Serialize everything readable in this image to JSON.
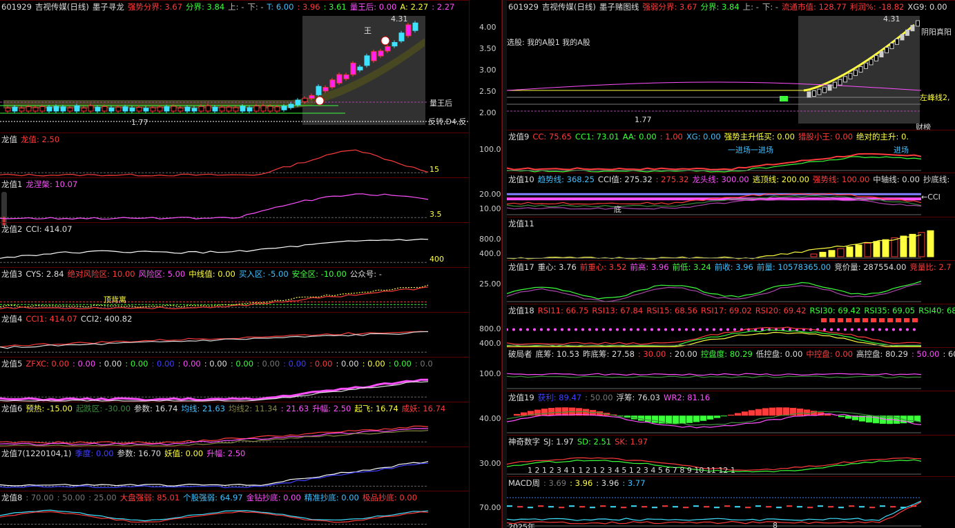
{
  "title_bar": {
    "code": "601929",
    "name": "吉视传媒(日线)"
  },
  "left": {
    "main": {
      "items": [
        {
          "t": "墨子寻龙",
          "c": "#ddd"
        },
        {
          "t": "强势分界: 3.67",
          "c": "#ff3c3c"
        },
        {
          "t": "分界: 3.84",
          "c": "#3cff3c"
        },
        {
          "t": "上: -",
          "c": "#bbb"
        },
        {
          "t": "下: -",
          "c": "#bbb"
        },
        {
          "t": "T: 6.00",
          "c": "#40c0ff"
        },
        {
          "t": ": 3.96",
          "c": "#ff3c3c"
        },
        {
          "t": ": 3.61",
          "c": "#3cff3c"
        },
        {
          "t": "量王后: 0.00",
          "c": "#ff50ff"
        },
        {
          "t": "A: 2.27",
          "c": "#ffff40"
        },
        {
          "t": ": 2.27",
          "c": "#ff50ff"
        }
      ],
      "ticks": [
        "4.00",
        "3.50",
        "3.00",
        "2.50",
        "2.00"
      ],
      "low_label": "1.77",
      "high_label": "4.31",
      "right_labels": [
        "量王后",
        "反转,D4,反"
      ],
      "text_wang": "王"
    },
    "panels": [
      {
        "items": [
          {
            "t": "龙值",
            "c": "#ddd"
          },
          {
            "t": "龙值: 2.50",
            "c": "#ff3c3c"
          }
        ],
        "ticks": [
          "100.0"
        ],
        "marks": [
          "15"
        ]
      },
      {
        "items": [
          {
            "t": "龙值1",
            "c": "#ddd"
          },
          {
            "t": "龙涅槃: 10.07",
            "c": "#ff50ff"
          }
        ],
        "ticks": [
          "20.00",
          "10.00"
        ],
        "marks": [
          "3.5"
        ]
      },
      {
        "items": [
          {
            "t": "龙值2",
            "c": "#ddd"
          },
          {
            "t": "CCI: 414.07",
            "c": "#ddd"
          }
        ],
        "ticks": [
          "800.0",
          "400.0"
        ],
        "marks": [
          "400"
        ]
      },
      {
        "items": [
          {
            "t": "龙值3",
            "c": "#ddd"
          },
          {
            "t": "CYS: 2.84",
            "c": "#ddd"
          },
          {
            "t": "绝对风险区: 10.00",
            "c": "#ff3c3c"
          },
          {
            "t": "风险区: 5.00",
            "c": "#ff50ff"
          },
          {
            "t": "中线值: 0.00",
            "c": "#ffff40"
          },
          {
            "t": "买入区: -5.00",
            "c": "#40c0ff"
          },
          {
            "t": "安全区: -10.00",
            "c": "#3cff3c"
          },
          {
            "t": "公众号: -",
            "c": "#ddd"
          }
        ],
        "ticks": [
          "25.00"
        ],
        "marks": [
          "顶背离"
        ]
      },
      {
        "items": [
          {
            "t": "龙值4",
            "c": "#ddd"
          },
          {
            "t": "CCI1: 414.07",
            "c": "#ff3c3c"
          },
          {
            "t": "CCI2: 400.82",
            "c": "#ddd"
          }
        ],
        "ticks": [
          "800.0",
          "400.0"
        ],
        "marks": []
      },
      {
        "items": [
          {
            "t": "龙值5",
            "c": "#ddd"
          },
          {
            "t": "ZFXC: 0.00",
            "c": "#ff3c3c"
          },
          {
            "t": ": 0.00",
            "c": "#ff50ff"
          },
          {
            "t": ": 0.00",
            "c": "#ddd"
          },
          {
            "t": ": 0.00",
            "c": "#3cff3c"
          },
          {
            "t": ": 0.00",
            "c": "#4040ff"
          },
          {
            "t": ": 0.00",
            "c": "#ff50ff"
          },
          {
            "t": ": 0.00",
            "c": "#ddd"
          },
          {
            "t": ": 0.00",
            "c": "#3cff3c"
          },
          {
            "t": ": 0.00",
            "c": "#777"
          },
          {
            "t": ": 0.00",
            "c": "#4040ff"
          },
          {
            "t": ": 0.00",
            "c": "#ff3c3c"
          },
          {
            "t": ": 0.00",
            "c": "#ddd"
          },
          {
            "t": ": 0.00",
            "c": "#ffff40"
          },
          {
            "t": ": 0.00",
            "c": "#3cff3c"
          },
          {
            "t": ": 0.0",
            "c": "#777"
          }
        ],
        "ticks": [
          "100.0"
        ],
        "marks": []
      },
      {
        "items": [
          {
            "t": "龙值6",
            "c": "#ddd"
          },
          {
            "t": "预热: -15.00",
            "c": "#ffff40"
          },
          {
            "t": "起跌区: -30.00",
            "c": "#3c8c3c"
          },
          {
            "t": "参数: 16.74",
            "c": "#ddd"
          },
          {
            "t": "均线: 21.63",
            "c": "#40c0ff"
          },
          {
            "t": "均线2: 11.34",
            "c": "#888844"
          },
          {
            "t": ": 21.63",
            "c": "#ff50ff"
          },
          {
            "t": "升幅: 2.50",
            "c": "#ff50ff"
          },
          {
            "t": "起飞: 16.74",
            "c": "#ffff40"
          },
          {
            "t": "成妖: 16.74",
            "c": "#ff3c3c"
          }
        ],
        "ticks": [
          "40.00"
        ],
        "marks": []
      },
      {
        "items": [
          {
            "t": "龙值7(1220104,1)",
            "c": "#ddd"
          },
          {
            "t": "季度: 0.00",
            "c": "#4040ff"
          },
          {
            "t": "参数: 16.70",
            "c": "#ddd"
          },
          {
            "t": "妖值: 0.00",
            "c": "#ffff40"
          },
          {
            "t": "升幅: 2.50",
            "c": "#ff50ff"
          }
        ],
        "ticks": [
          "30.00"
        ],
        "marks": []
      },
      {
        "items": [
          {
            "t": "龙值8",
            "c": "#ddd"
          },
          {
            "t": ": 70.00",
            "c": "#777"
          },
          {
            "t": ": 50.00",
            "c": "#777"
          },
          {
            "t": ": 25.00",
            "c": "#777"
          },
          {
            "t": "大盘强弱: 85.01",
            "c": "#ff3c3c"
          },
          {
            "t": "个股强弱: 64.97",
            "c": "#40c0ff"
          },
          {
            "t": "金钻抄底: 0.00",
            "c": "#ff50ff"
          },
          {
            "t": "精准抄底: 0.00",
            "c": "#40c0ff"
          },
          {
            "t": "极品抄底: 0.00",
            "c": "#ff3c3c"
          }
        ],
        "ticks": [
          "70.00"
        ],
        "marks": []
      }
    ]
  },
  "right": {
    "main": {
      "items": [
        {
          "t": "墨子赌图线",
          "c": "#ddd"
        },
        {
          "t": "强弱分界: 3.67",
          "c": "#ff3c3c"
        },
        {
          "t": "分界: 3.84",
          "c": "#3cff3c"
        },
        {
          "t": "上: -",
          "c": "#bbb"
        },
        {
          "t": "下: -",
          "c": "#bbb"
        },
        {
          "t": "流通市值: 128.77",
          "c": "#ff3c3c"
        },
        {
          "t": "利润%: -18.82",
          "c": "#ff3c3c"
        },
        {
          "t": "XG9: 0.00",
          "c": "#ddd"
        }
      ],
      "selection": "选股: 我的A股1 我的A股",
      "high_label": "4.31",
      "low_label": "1.77",
      "right_labels": [
        "阴阳真阳",
        "左峰线2,",
        "财榜"
      ]
    },
    "panels": [
      {
        "items": [
          {
            "t": "龙值9",
            "c": "#ddd"
          },
          {
            "t": "CC: 75.65",
            "c": "#ff3c3c"
          },
          {
            "t": "CC1: 73.01",
            "c": "#3cff3c"
          },
          {
            "t": "AA: 0.00",
            "c": "#3cff3c"
          },
          {
            "t": ": 1.00",
            "c": "#ff3c3c"
          },
          {
            "t": "XG: 0.00",
            "c": "#40c0ff"
          },
          {
            "t": "强势主升低买: 0.00",
            "c": "#ffff40"
          },
          {
            "t": "猎股小王: 0.00",
            "c": "#ff3c3c"
          },
          {
            "t": "绝对的主升: 0.",
            "c": "#ffff40"
          }
        ],
        "marks": [
          "一进场一进场",
          "进场"
        ]
      },
      {
        "items": [
          {
            "t": "龙值10",
            "c": "#ddd"
          },
          {
            "t": "趋势线: 368.25",
            "c": "#40c0ff"
          },
          {
            "t": "CCI值: 275.32",
            "c": "#ddd"
          },
          {
            "t": ": 275.32",
            "c": "#ff3c3c"
          },
          {
            "t": "龙头线: 300.00",
            "c": "#ff50ff"
          },
          {
            "t": "逃顶线: 200.00",
            "c": "#ffff40"
          },
          {
            "t": "强势线: 100.00",
            "c": "#ff3c3c"
          },
          {
            "t": "中轴线: 0.00",
            "c": "#ddd"
          },
          {
            "t": "抄底线:",
            "c": "#ddd"
          }
        ],
        "marks": [
          "←CCI",
          "底"
        ]
      },
      {
        "items": [
          {
            "t": "龙值11",
            "c": "#ddd"
          }
        ],
        "marks": []
      },
      {
        "items": [
          {
            "t": "龙值17",
            "c": "#ddd"
          },
          {
            "t": "重心: 3.76",
            "c": "#ddd"
          },
          {
            "t": "前重心: 3.52",
            "c": "#ff3c3c"
          },
          {
            "t": "前高: 3.96",
            "c": "#ff50ff"
          },
          {
            "t": "前低: 3.24",
            "c": "#3cff3c"
          },
          {
            "t": "前收: 3.96",
            "c": "#40c0ff"
          },
          {
            "t": "前量: 10578365.00",
            "c": "#40c0ff"
          },
          {
            "t": "竞价量: 287554.00",
            "c": "#ddd"
          },
          {
            "t": "竞量比: 2.7",
            "c": "#ff3c3c"
          }
        ],
        "marks": []
      },
      {
        "items": [
          {
            "t": "龙值18",
            "c": "#ddd"
          },
          {
            "t": "RSI11: 66.75",
            "c": "#ff3c3c"
          },
          {
            "t": "RSI13: 67.84",
            "c": "#ff3c3c"
          },
          {
            "t": "RSI15: 68.56",
            "c": "#ff3c3c"
          },
          {
            "t": "RSI17: 69.02",
            "c": "#ff3c3c"
          },
          {
            "t": "RSI20: 69.42",
            "c": "#ff3c3c"
          },
          {
            "t": "RSI30: 69.42",
            "c": "#3cff3c"
          },
          {
            "t": "RSI35: 69.05",
            "c": "#3cff3c"
          },
          {
            "t": "RSI40: 68.5",
            "c": "#3cff3c"
          }
        ],
        "marks": []
      },
      {
        "items": [
          {
            "t": "破局者",
            "c": "#ddd"
          },
          {
            "t": "底筹: 10.53",
            "c": "#ddd"
          },
          {
            "t": "昨底筹: 27.58",
            "c": "#ddd"
          },
          {
            "t": ": 30.00",
            "c": "#ff3c3c"
          },
          {
            "t": ": 20.00",
            "c": "#ddd"
          },
          {
            "t": "控盘度: 80.29",
            "c": "#3cff3c"
          },
          {
            "t": "低控盘: 0.00",
            "c": "#ddd"
          },
          {
            "t": "中控盘: 0.00",
            "c": "#ff3c3c"
          },
          {
            "t": "高控盘: 80.29",
            "c": "#ddd"
          },
          {
            "t": ": 50.00",
            "c": "#ff50ff"
          },
          {
            "t": ": 60",
            "c": "#ddd"
          }
        ],
        "marks": []
      },
      {
        "items": [
          {
            "t": "龙值19",
            "c": "#ddd"
          },
          {
            "t": "获利: 89.47",
            "c": "#4040ff"
          },
          {
            "t": ": 50.00",
            "c": "#777"
          },
          {
            "t": "浮筹: 76.03",
            "c": "#ddd"
          },
          {
            "t": "WR2: 81.16",
            "c": "#ff50ff"
          }
        ],
        "marks": []
      },
      {
        "items": [
          {
            "t": "神奇数字",
            "c": "#ddd"
          },
          {
            "t": "SJ: 1.97",
            "c": "#ddd"
          },
          {
            "t": "SD: 2.51",
            "c": "#3cff3c"
          },
          {
            "t": "SK: 1.97",
            "c": "#ff3c3c"
          }
        ],
        "marks": [
          "1  2    1  2  3  4        1     1  2     1  2  3  4  5        1  2  3  4  5  6  7  8  9  10 11 12          1"
        ]
      },
      {
        "items": [
          {
            "t": "MACD周",
            "c": "#ddd"
          },
          {
            "t": ": 3.69",
            "c": "#777"
          },
          {
            "t": ": 3.96",
            "c": "#ffff40"
          },
          {
            "t": ": 3.96",
            "c": "#ddd"
          },
          {
            "t": ": 3.77",
            "c": "#40c0ff"
          }
        ],
        "marks": [
          "2025年",
          "8"
        ]
      }
    ]
  }
}
